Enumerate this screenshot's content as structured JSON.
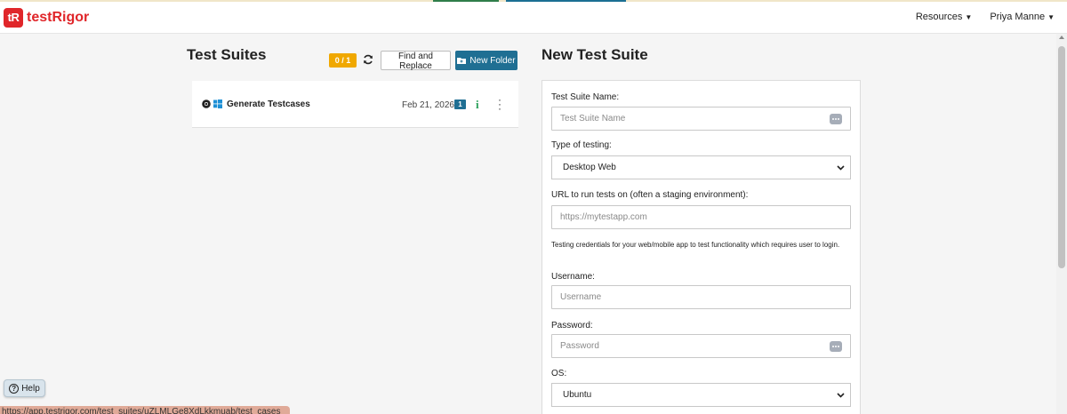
{
  "brand": {
    "badge": "tR",
    "name": "testRigor"
  },
  "nav": {
    "resources": "Resources",
    "user": "Priya Manne"
  },
  "suites": {
    "title": "Test Suites",
    "counter": "0 / 1",
    "find_replace_label": "Find and Replace",
    "new_folder_label": "New Folder",
    "items": [
      {
        "name": "Generate Testcases",
        "date": "Feb 21, 2026",
        "count": "1"
      }
    ]
  },
  "new_suite": {
    "title": "New Test Suite",
    "name_label": "Test Suite Name:",
    "name_placeholder": "Test Suite Name",
    "type_label": "Type of testing:",
    "type_value": "Desktop Web",
    "url_label": "URL to run tests on (often a staging environment):",
    "url_placeholder": "https://mytestapp.com",
    "credentials_note": "Testing credentials for your web/mobile app to test functionality which requires user to login.",
    "username_label": "Username:",
    "username_placeholder": "Username",
    "password_label": "Password:",
    "password_placeholder": "Password",
    "os_label": "OS:",
    "os_value": "Ubuntu"
  },
  "help_label": "Help",
  "status_url": "https://app.testrigor.com/test_suites/uZLMLGe8XdLkkmuab/test_cases",
  "colors": {
    "brand_red": "#e0262a",
    "primary_blue": "#1f6f93",
    "counter_orange": "#f0a800",
    "info_green": "#2aa05a"
  }
}
